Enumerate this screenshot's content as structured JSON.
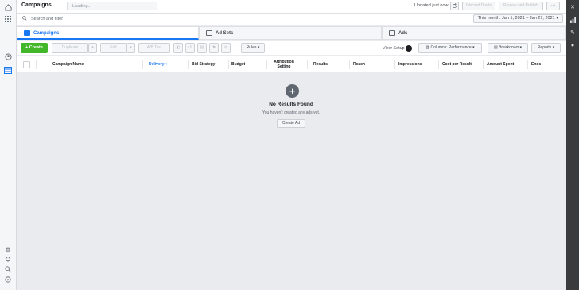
{
  "header": {
    "title": "Campaigns",
    "name_placeholder": "Loading...",
    "updated": "Updated just now",
    "discard": "Discard Drafts",
    "review": "Review and Publish",
    "more": "···"
  },
  "search": {
    "placeholder": "Search and filter",
    "date_range": "This month: Jan 1, 2021 – Jan 27, 2021 ▾"
  },
  "tabs": [
    {
      "label": "Campaigns"
    },
    {
      "label": "Ad Sets"
    },
    {
      "label": "Ads"
    }
  ],
  "toolbar": {
    "create": "+ Create",
    "duplicate": "Duplicate",
    "edit": "Edit",
    "ab_test": "A/B Test",
    "rules": "Rules ▾",
    "view_setup": "View Setup",
    "columns": "Columns: Performance ▾",
    "breakdown": "Breakdown ▾",
    "reports": "Reports ▾"
  },
  "table": {
    "columns": [
      "Campaign Name",
      "Delivery ↑",
      "Bid Strategy",
      "Budget",
      "Attribution Setting",
      "Results",
      "Reach",
      "Impressions",
      "Cost per Result",
      "Amount Spent",
      "Ends"
    ]
  },
  "empty": {
    "title": "No Results Found",
    "subtitle": "You haven't created any ads yet.",
    "button": "Create Ad"
  },
  "colors": {
    "accent": "#1877f2",
    "create_green": "#42b72a"
  }
}
